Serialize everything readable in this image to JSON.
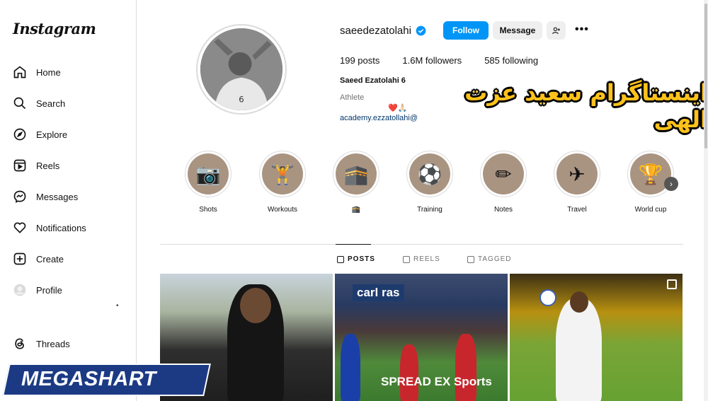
{
  "brand": {
    "logo": "Instagram"
  },
  "sidebar": {
    "items": [
      {
        "label": "Home",
        "icon": "home-icon"
      },
      {
        "label": "Search",
        "icon": "search-icon"
      },
      {
        "label": "Explore",
        "icon": "compass-icon"
      },
      {
        "label": "Reels",
        "icon": "reels-icon"
      },
      {
        "label": "Messages",
        "icon": "messenger-icon"
      },
      {
        "label": "Notifications",
        "icon": "heart-icon"
      },
      {
        "label": "Create",
        "icon": "plus-square-icon"
      },
      {
        "label": "Profile",
        "icon": "avatar-icon"
      },
      {
        "label": "Threads",
        "icon": "threads-icon"
      }
    ]
  },
  "profile": {
    "username": "saeedezatolahi",
    "follow_label": "Follow",
    "message_label": "Message",
    "posts": "199 posts",
    "followers": "1.6M followers",
    "following": "585 following",
    "full_name": "Saeed Ezatolahi 6",
    "category": "Athlete",
    "bio_emoji": "❤️🙏🏻",
    "link": "academy.ezzatollahi@"
  },
  "overlay": {
    "title": "اینستاگرام سعید عزت الهی",
    "watermark": "MEGASHART"
  },
  "highlights": [
    {
      "label": "Shots",
      "icon": "📷"
    },
    {
      "label": "Workouts",
      "icon": "🏋"
    },
    {
      "label": "🕋",
      "icon": "🕋"
    },
    {
      "label": "Training",
      "icon": "⚽"
    },
    {
      "label": "Notes",
      "icon": "✏"
    },
    {
      "label": "Travel",
      "icon": "✈"
    },
    {
      "label": "World cup",
      "icon": "🏆"
    }
  ],
  "tabs": [
    {
      "label": "POSTS"
    },
    {
      "label": "REELS"
    },
    {
      "label": "TAGGED"
    }
  ],
  "posts": [
    {
      "text": ""
    },
    {
      "sign": "carl ras",
      "banner": "SPREAD EX Sports"
    },
    {
      "text": ""
    }
  ],
  "colors": {
    "accent": "#0095f6",
    "highlight_bg": "#a99482",
    "overlay_text": "#ffc21a",
    "watermark_bg": "#1c3a84"
  }
}
